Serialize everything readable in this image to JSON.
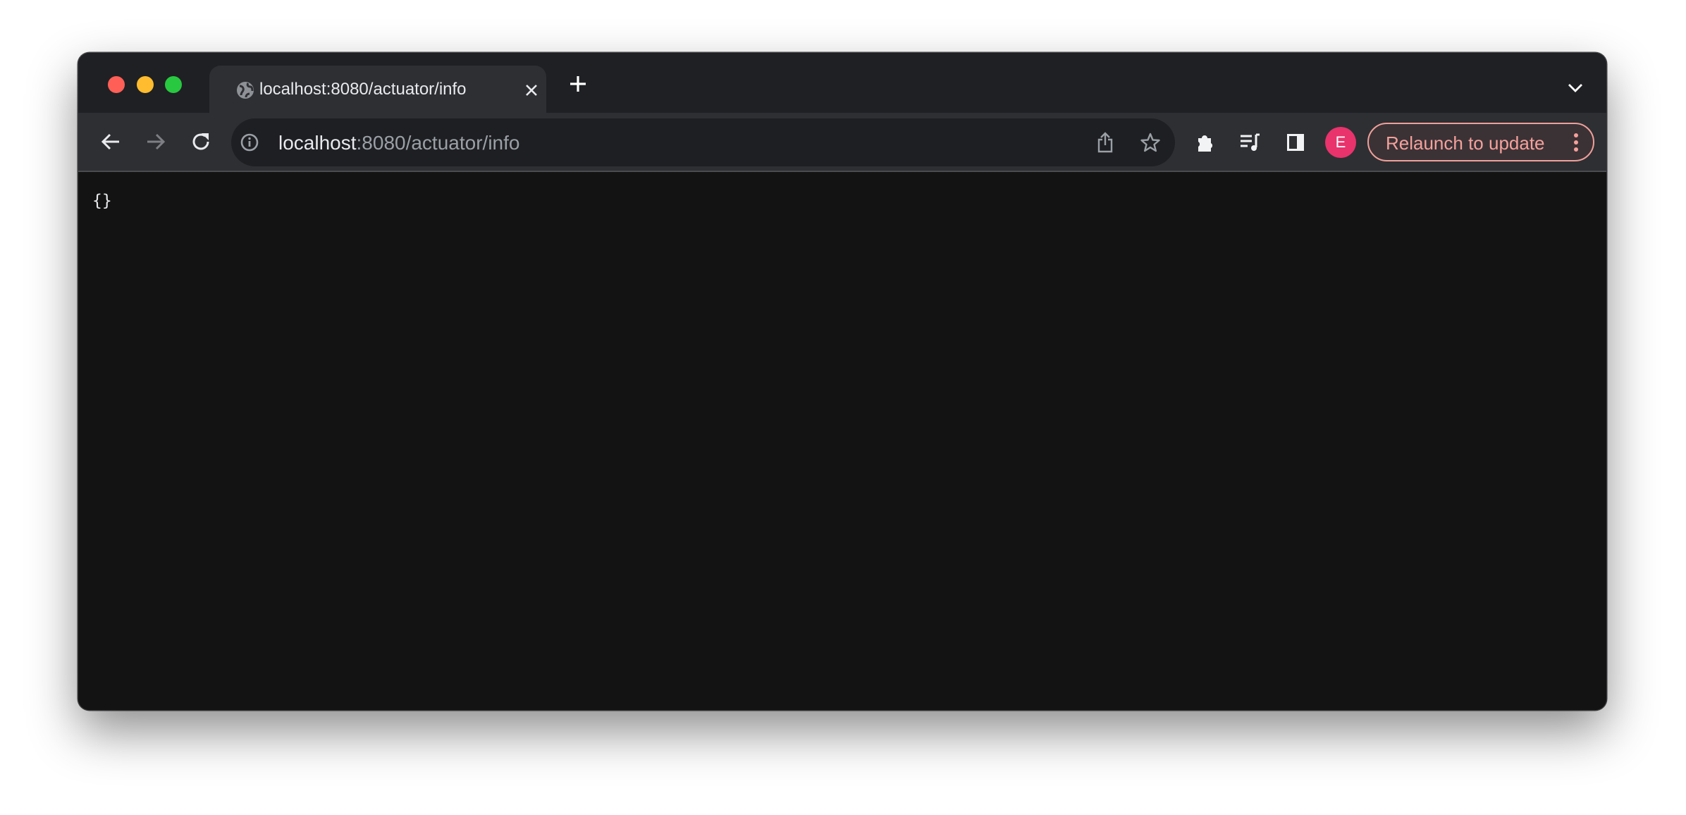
{
  "window": {
    "traffic_lights": {
      "close": "#ff5f57",
      "minimize": "#febc2e",
      "maximize": "#28c840"
    }
  },
  "tab": {
    "title": "localhost:8080/actuator/info",
    "icon": "globe-icon"
  },
  "toolbar": {
    "url_host": "localhost",
    "url_rest": ":8080/actuator/info",
    "avatar_initial": "E",
    "avatar_color": "#e8336c",
    "relaunch_label": "Relaunch to update",
    "relaunch_color": "#f4a19b"
  },
  "page": {
    "body_text": "{}"
  }
}
